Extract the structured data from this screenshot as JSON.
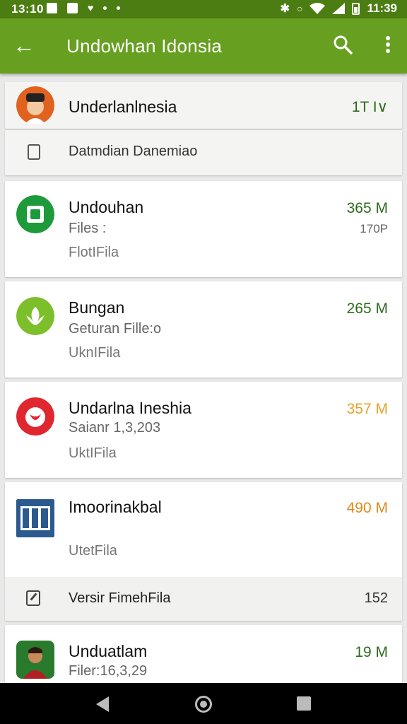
{
  "status_bar": {
    "time_left": "13:10",
    "time_right": "11:39"
  },
  "app_bar": {
    "title": "Undowhan Idonsia"
  },
  "header_card": {
    "name": "Underlanlnesia",
    "size": "1T I∨"
  },
  "sub_row": {
    "label": "Datmdian Danemiao"
  },
  "items": [
    {
      "name": "Undouhan",
      "sub": "Files :",
      "size": "365 M",
      "size2": "170P",
      "tag": "FlotIFila",
      "size_color": "#2e6b1e"
    },
    {
      "name": "Bungan",
      "sub": "Geturan Fille:o",
      "size": "265 M",
      "tag": "UknIFila",
      "size_color": "#2e6b1e"
    },
    {
      "name": "Undarlna Ineshia",
      "sub": "Saianr 1,3,203",
      "size": "357 M",
      "tag": "UktIFila",
      "size_color": "#e8a02a"
    },
    {
      "name": "Imoorinakbal",
      "sub": "",
      "size": "490 M",
      "tag": "UtetFila",
      "size_color": "#e08a1a"
    },
    {
      "name": "Unduatlam",
      "sub": "Filer:16,3,29",
      "size": "19 M",
      "tag": "",
      "size_color": "#2e6b1e"
    }
  ],
  "version_row": {
    "label": "Versir FimehFila",
    "value": "152"
  },
  "icons": {
    "back": "arrow-left-icon",
    "search": "search-icon",
    "more": "more-vert-icon",
    "avatar_header": "avatar-icon",
    "app1": "file-app-icon",
    "app2": "leaf-app-icon",
    "app3": "bird-app-icon",
    "app4": "grid-app-icon",
    "app5": "person-avatar-icon",
    "edit": "edit-icon",
    "nav_back": "nav-back-icon",
    "nav_home": "nav-home-icon",
    "nav_recent": "nav-recents-icon"
  },
  "colors": {
    "status_bar": "#4c7d12",
    "app_bar": "#67a021",
    "accent_green": "#2e6b1e",
    "accent_orange": "#e8a02a"
  }
}
